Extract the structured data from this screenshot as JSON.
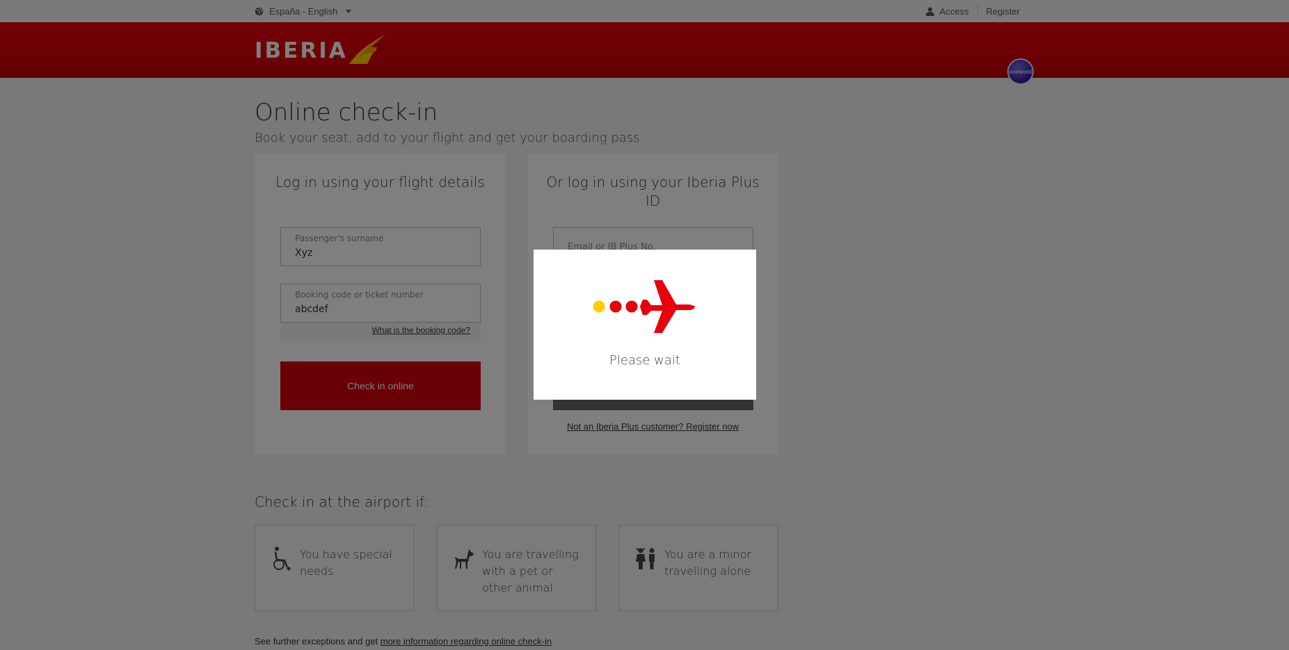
{
  "topbar": {
    "language": "España - English",
    "access": "Access",
    "register": "Register"
  },
  "header": {
    "logo_text": "IBERIA",
    "oneworld": "oneworld"
  },
  "page": {
    "title": "Online check-in",
    "subtitle": "Book your seat, add to your flight and get your boarding pass"
  },
  "flight_login": {
    "heading": "Log in using your flight details",
    "surname_label": "Passenger's surname",
    "surname_value": "Xyz",
    "booking_label": "Booking code or ticket number",
    "booking_value": "abcdef",
    "help_link": "What is the booking code?",
    "submit": "Check in online"
  },
  "plus_login": {
    "heading": "Or log in using your Iberia Plus ID",
    "email_placeholder": "Email or IB Plus No.",
    "register_link": "Not an Iberia Plus customer? Register now"
  },
  "airport": {
    "title": "Check in at the airport if:",
    "cards": [
      {
        "text": "You have special needs",
        "icon": "wheelchair-icon"
      },
      {
        "text": "You are travelling with a pet or other animal",
        "icon": "dog-icon"
      },
      {
        "text": "You are a minor travelling alone",
        "icon": "children-icon"
      }
    ]
  },
  "footer": {
    "text": "See further exceptions and get ",
    "link": "more information regarding online check-in"
  },
  "modal": {
    "text": "Please wait"
  },
  "colors": {
    "brand_red": "#d3000a",
    "yellow": "#ffcc00"
  }
}
